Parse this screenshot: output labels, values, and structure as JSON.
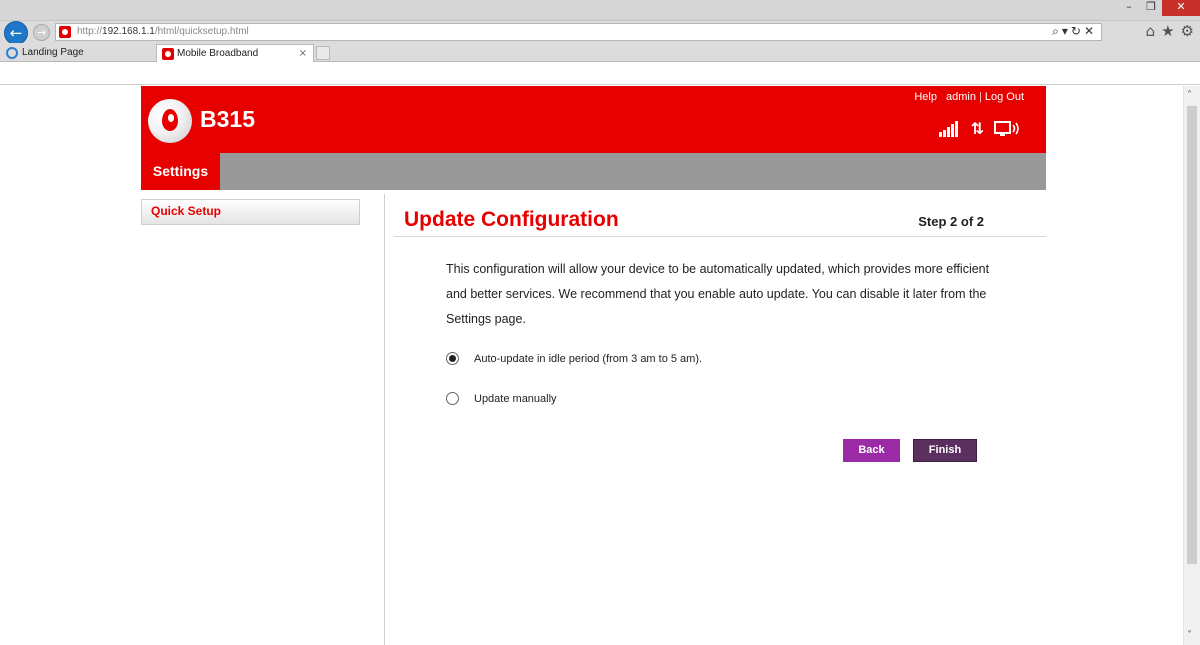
{
  "browser": {
    "url_prefix": "http://",
    "url_host": "192.168.1.1",
    "url_path": "/html/quicksetup.html",
    "tabs": [
      {
        "label": "Landing Page",
        "active": false
      },
      {
        "label": "Mobile Broadband",
        "active": true
      }
    ],
    "tab_close_symbol": "×",
    "window_controls": {
      "minimize": "–",
      "maximize": "❐",
      "close": "✕"
    }
  },
  "router": {
    "model": "B315",
    "top_links": {
      "help": "Help",
      "user": "admin",
      "logout": "Log Out"
    },
    "menu": {
      "active": "Settings"
    },
    "sidebar": {
      "items": [
        {
          "label": "Quick Setup"
        }
      ]
    },
    "status_icons": [
      "signal-icon",
      "data-transfer-icon",
      "device-connection-icon"
    ],
    "brand_color": "#e60000",
    "menu_color": "#999999"
  },
  "content": {
    "title": "Update Configuration",
    "step": "Step 2 of 2",
    "description": "This configuration will allow your device to be automatically updated, which provides more efficient and better services. We recommend that you enable auto update. You can disable it later from the Settings page.",
    "options": [
      {
        "label": "Auto-update in idle period (from 3 am to 5 am).",
        "selected": true
      },
      {
        "label": "Update manually",
        "selected": false
      }
    ],
    "buttons": {
      "back": {
        "label": "Back",
        "color": "#9a2aa6"
      },
      "finish": {
        "label": "Finish",
        "color": "#5c2f61"
      }
    }
  }
}
